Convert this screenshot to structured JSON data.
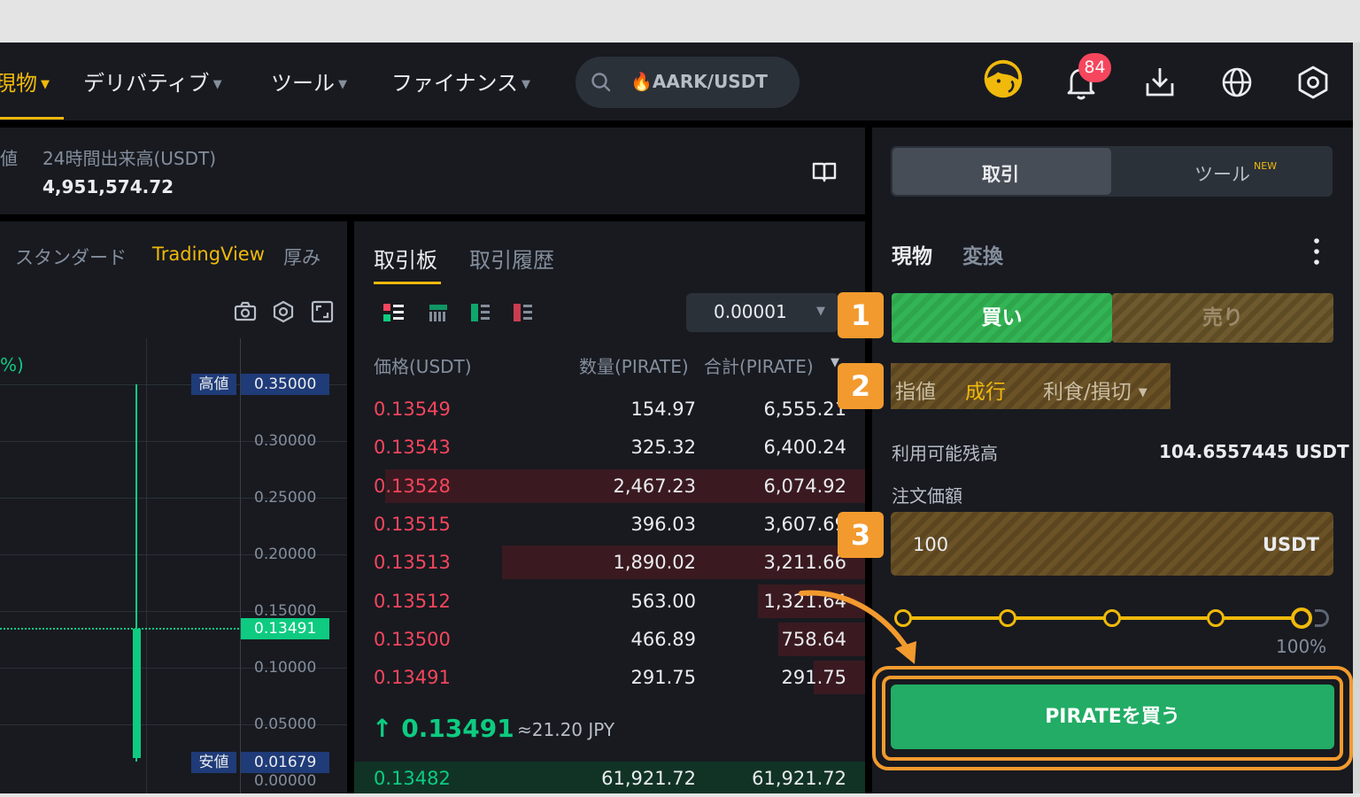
{
  "nav": {
    "items": [
      {
        "label": "現物"
      },
      {
        "label": "デリバティブ"
      },
      {
        "label": "ツール"
      },
      {
        "label": "ファイナンス"
      }
    ],
    "search_text": "🔥AARK/USDT",
    "notification_count": "84"
  },
  "ticker": {
    "clipped_label": "値",
    "volume_label": "24時間出来高(USDT)",
    "volume_value": "4,951,574.72"
  },
  "chart": {
    "tabs": [
      "スタンダード",
      "TradingView",
      "厚み"
    ],
    "partial_label": "%)",
    "price_ticks": [
      "0.30000",
      "0.25000",
      "0.20000",
      "0.15000",
      "0.10000",
      "0.05000",
      "0.00000"
    ],
    "high_label": "高値",
    "high_value": "0.35000",
    "current_value": "0.13491",
    "low_label": "安値",
    "low_value": "0.01679"
  },
  "orderbook": {
    "tabs": [
      "取引板",
      "取引履歴"
    ],
    "tick_size": "0.00001",
    "headers": {
      "price": "価格(USDT)",
      "qty": "数量(PIRATE)",
      "total": "合計(PIRATE)"
    },
    "asks": [
      {
        "price": "0.13549",
        "qty": "154.97",
        "total": "6,555.21",
        "depth": 0
      },
      {
        "price": "0.13543",
        "qty": "325.32",
        "total": "6,400.24",
        "depth": 0
      },
      {
        "price": "0.13528",
        "qty": "2,467.23",
        "total": "6,074.92",
        "depth": 0.94
      },
      {
        "price": "0.13515",
        "qty": "396.03",
        "total": "3,607.69",
        "depth": 0
      },
      {
        "price": "0.13513",
        "qty": "1,890.02",
        "total": "3,211.66",
        "depth": 0.71
      },
      {
        "price": "0.13512",
        "qty": "563.00",
        "total": "1,321.64",
        "depth": 0.21
      },
      {
        "price": "0.13500",
        "qty": "466.89",
        "total": "758.64",
        "depth": 0.17
      },
      {
        "price": "0.13491",
        "qty": "291.75",
        "total": "291.75",
        "depth": 0.1
      }
    ],
    "last_price": "↑ 0.13491",
    "last_price_jpy": "≈21.20 JPY",
    "bids": [
      {
        "price": "0.13482",
        "qty": "61,921.72",
        "total": "61,921.72",
        "depth": 1.0
      }
    ]
  },
  "trade": {
    "tabs": {
      "trade": "取引",
      "tools": "ツール",
      "tools_badge": "NEW"
    },
    "sub_tabs": [
      "現物",
      "変換"
    ],
    "buy_label": "買い",
    "sell_label": "売り",
    "order_types": [
      "指値",
      "成行",
      "利食/損切"
    ],
    "available_label": "利用可能残高",
    "available_value": "104.6557445 USDT",
    "price_label": "注文価額",
    "price_value": "100",
    "price_unit": "USDT",
    "slider_percent": "100%",
    "slider_fraction": 1.0,
    "cta": "PIRATEを買う"
  },
  "annotations": {
    "steps": [
      "1",
      "2",
      "3"
    ],
    "accent": "#f29a2e"
  },
  "colors": {
    "brand": "#f0b90b",
    "buy": "#0ecb81",
    "sell": "#f6465d",
    "panel": "#181a20"
  }
}
